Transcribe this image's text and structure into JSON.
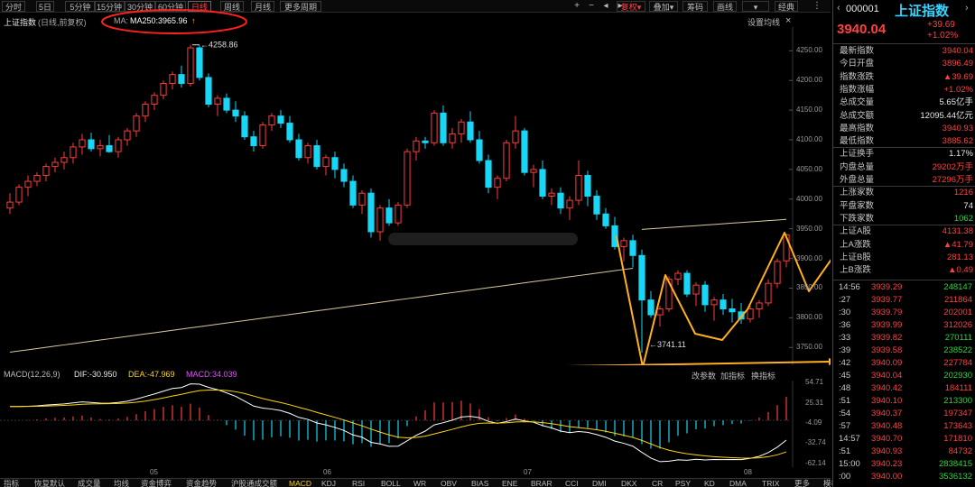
{
  "toolbar": {
    "periods": [
      "分时",
      "5日",
      "5分钟",
      "15分钟",
      "30分钟",
      "60分钟",
      "日线",
      "周线",
      "月线",
      "更多周期"
    ],
    "active_period": "日线",
    "icons": [
      "add-icon",
      "minus-icon",
      "left-icon",
      "right-icon"
    ],
    "buttons": [
      "复权",
      "叠加",
      "画线",
      "经典"
    ],
    "extra_buttons": [
      "筹码"
    ],
    "setting_label": "设置均线",
    "close_symbol": "×"
  },
  "chart": {
    "index_name": "上证指数",
    "mode": "(日线,前复权)",
    "ma_prefix": "MA:",
    "ma_label": "MA250:3965.96",
    "ma_arrow": "↑",
    "high_annotation": "4258.86",
    "low_annotation": "3741.11",
    "price_ticks": [
      "4250.00",
      "4200.00",
      "4150.00",
      "4100.00",
      "4050.00",
      "4000.00",
      "3950.00",
      "3900.00",
      "3850.00",
      "3800.00",
      "3750.00"
    ],
    "macd_label": "MACD(12,26,9)",
    "dif_label": "DIF:-30.950",
    "dea_label": "DEA:-47.969",
    "macd_value_label": "MACD:34.039",
    "macd_ticks": [
      "54.71",
      "25.31",
      "-4.09",
      "-32.74",
      "-62.14"
    ],
    "macd_buttons": [
      "改参数",
      "加指标",
      "换指标"
    ],
    "month_labels": [
      "05",
      "06",
      "07",
      "08"
    ],
    "colors": {
      "up": "#ff3b3b",
      "down": "#18d6f5",
      "ma": "#d7c9a0",
      "dif": "#ffffff",
      "dea": "#ffd400",
      "annotation": "#ffb020",
      "circle": "#ff2020"
    }
  },
  "right_panel": {
    "code": "000001",
    "name": "上证指数",
    "price": "3940.04",
    "change": "+39.69",
    "change_pct": "+1.02%",
    "stats": [
      {
        "label": "最新指数",
        "value": "3940.04",
        "color": "red"
      },
      {
        "label": "今日开盘",
        "value": "3896.49",
        "color": "red"
      },
      {
        "label": "指数涨跌",
        "value": "▲39.69",
        "color": "red"
      },
      {
        "label": "指数涨幅",
        "value": "+1.02%",
        "color": "red"
      },
      {
        "label": "总成交量",
        "value": "5.65亿手",
        "color": "white"
      },
      {
        "label": "总成交额",
        "value": "12095.44亿元",
        "color": "white"
      },
      {
        "label": "最高指数",
        "value": "3940.93",
        "color": "red"
      },
      {
        "label": "最低指数",
        "value": "3885.62",
        "color": "red"
      },
      {
        "label": "上证换手",
        "value": "1.17%",
        "color": "white"
      },
      {
        "label": "内盘总量",
        "value": "29202万手",
        "color": "red"
      },
      {
        "label": "外盘总量",
        "value": "27296万手",
        "color": "red"
      },
      {
        "label": "上涨家数",
        "value": "1216",
        "color": "red"
      },
      {
        "label": "平盘家数",
        "value": "74",
        "color": "white"
      },
      {
        "label": "下跌家数",
        "value": "1062",
        "color": "green"
      },
      {
        "label": "上证A股",
        "value": "4131.38",
        "color": "red"
      },
      {
        "label": "上A涨跌",
        "value": "▲41.79",
        "color": "red"
      },
      {
        "label": "上证B股",
        "value": "281.13",
        "color": "red"
      },
      {
        "label": "上B涨跌",
        "value": "▲0.49",
        "color": "red"
      }
    ],
    "ticks": [
      {
        "time": "14:56",
        "price": "3939.29",
        "vol": "248147",
        "pc": "red",
        "vc": "green"
      },
      {
        "time": ":27",
        "price": "3939.77",
        "vol": "211864",
        "pc": "red",
        "vc": "red"
      },
      {
        "time": ":30",
        "price": "3939.79",
        "vol": "202001",
        "pc": "red",
        "vc": "red"
      },
      {
        "time": ":36",
        "price": "3939.99",
        "vol": "312026",
        "pc": "red",
        "vc": "red"
      },
      {
        "time": ":33",
        "price": "3939.82",
        "vol": "270111",
        "pc": "red",
        "vc": "green"
      },
      {
        "time": ":39",
        "price": "3939.58",
        "vol": "238522",
        "pc": "red",
        "vc": "green"
      },
      {
        "time": ":42",
        "price": "3940.09",
        "vol": "227784",
        "pc": "red",
        "vc": "red"
      },
      {
        "time": ":45",
        "price": "3940.04",
        "vol": "202930",
        "pc": "red",
        "vc": "green"
      },
      {
        "time": ":48",
        "price": "3940.42",
        "vol": "184111",
        "pc": "red",
        "vc": "red"
      },
      {
        "time": ":51",
        "price": "3940.10",
        "vol": "213300",
        "pc": "red",
        "vc": "green"
      },
      {
        "time": ":54",
        "price": "3940.37",
        "vol": "197347",
        "pc": "red",
        "vc": "red"
      },
      {
        "time": ":57",
        "price": "3940.48",
        "vol": "173643",
        "pc": "red",
        "vc": "red"
      },
      {
        "time": "14:57",
        "price": "3940.70",
        "vol": "171810",
        "pc": "red",
        "vc": "red"
      },
      {
        "time": ":51",
        "price": "3940.93",
        "vol": "84732",
        "pc": "red",
        "vc": "red"
      },
      {
        "time": "15:00",
        "price": "3940.23",
        "vol": "2838415",
        "pc": "red",
        "vc": "green"
      },
      {
        "time": ":00",
        "price": "3940.00",
        "vol": "3536132",
        "pc": "red",
        "vc": "green"
      }
    ]
  },
  "bottom_tabs": [
    "指标",
    "恢复默认",
    "成交量",
    "均线",
    "资金博弈",
    "资金趋势",
    "沪股通成交额",
    "MACD",
    "KDJ",
    "RSI",
    "BOLL",
    "WR",
    "OBV",
    "BIAS",
    "ENE",
    "BRAR",
    "CCI",
    "DMI",
    "DKX",
    "CR",
    "PSY",
    "KD",
    "DMA",
    "TRIX",
    "更多",
    "模板"
  ],
  "selected_tab": "MACD",
  "chart_data": {
    "type": "candlestick",
    "title": "上证指数 (日线,前复权)",
    "ylim": [
      3720,
      4290
    ],
    "x_labels": [
      "05",
      "06",
      "07",
      "08"
    ],
    "price_annotations": {
      "high": 4258.86,
      "low": 3741.11
    },
    "ma250_last": 3965.96,
    "candles": [
      [
        3985,
        4010,
        3975,
        3995
      ],
      [
        3995,
        4025,
        3990,
        4020
      ],
      [
        4020,
        4040,
        4005,
        4030
      ],
      [
        4030,
        4045,
        4022,
        4040
      ],
      [
        4040,
        4060,
        4030,
        4055
      ],
      [
        4055,
        4070,
        4045,
        4062
      ],
      [
        4062,
        4080,
        4050,
        4070
      ],
      [
        4070,
        4095,
        4060,
        4088
      ],
      [
        4088,
        4110,
        4075,
        4100
      ],
      [
        4100,
        4112,
        4080,
        4085
      ],
      [
        4085,
        4100,
        4072,
        4090
      ],
      [
        4090,
        4108,
        4078,
        4080
      ],
      [
        4080,
        4105,
        4070,
        4100
      ],
      [
        4100,
        4120,
        4090,
        4115
      ],
      [
        4115,
        4145,
        4105,
        4140
      ],
      [
        4140,
        4165,
        4130,
        4160
      ],
      [
        4160,
        4180,
        4150,
        4175
      ],
      [
        4175,
        4200,
        4168,
        4195
      ],
      [
        4195,
        4215,
        4185,
        4210
      ],
      [
        4210,
        4225,
        4188,
        4195
      ],
      [
        4195,
        4260,
        4190,
        4255
      ],
      [
        4255,
        4259,
        4200,
        4205
      ],
      [
        4205,
        4212,
        4155,
        4160
      ],
      [
        4160,
        4175,
        4140,
        4170
      ],
      [
        4170,
        4178,
        4145,
        4150
      ],
      [
        4150,
        4165,
        4130,
        4140
      ],
      [
        4140,
        4148,
        4100,
        4105
      ],
      [
        4105,
        4115,
        4080,
        4090
      ],
      [
        4090,
        4130,
        4085,
        4125
      ],
      [
        4125,
        4145,
        4115,
        4140
      ],
      [
        4140,
        4150,
        4120,
        4128
      ],
      [
        4128,
        4140,
        4095,
        4100
      ],
      [
        4100,
        4110,
        4065,
        4070
      ],
      [
        4070,
        4095,
        4060,
        4090
      ],
      [
        4090,
        4100,
        4050,
        4055
      ],
      [
        4055,
        4075,
        4040,
        4070
      ],
      [
        4070,
        4080,
        4035,
        4050
      ],
      [
        4050,
        4060,
        4020,
        4030
      ],
      [
        4030,
        4040,
        3985,
        3990
      ],
      [
        3990,
        4015,
        3975,
        4010
      ],
      [
        4010,
        4018,
        3935,
        3945
      ],
      [
        3945,
        3990,
        3930,
        3985
      ],
      [
        3985,
        4000,
        3955,
        3960
      ],
      [
        3960,
        3995,
        3955,
        3990
      ],
      [
        3990,
        4085,
        3985,
        4080
      ],
      [
        4080,
        4105,
        4065,
        4098
      ],
      [
        4098,
        4105,
        4085,
        4095
      ],
      [
        4095,
        4150,
        4090,
        4145
      ],
      [
        4145,
        4158,
        4090,
        4095
      ],
      [
        4095,
        4120,
        4085,
        4110
      ],
      [
        4110,
        4135,
        4095,
        4130
      ],
      [
        4130,
        4148,
        4095,
        4100
      ],
      [
        4100,
        4115,
        4060,
        4065
      ],
      [
        4065,
        4075,
        4010,
        4020
      ],
      [
        4020,
        4040,
        4000,
        4035
      ],
      [
        4035,
        4100,
        4030,
        4095
      ],
      [
        4095,
        4140,
        4085,
        4115
      ],
      [
        4115,
        4120,
        4040,
        4045
      ],
      [
        4045,
        4058,
        4020,
        4050
      ],
      [
        4050,
        4065,
        4000,
        4005
      ],
      [
        4005,
        4018,
        3990,
        4010
      ],
      [
        4010,
        4020,
        3975,
        3985
      ],
      [
        3985,
        4005,
        3965,
        3998
      ],
      [
        3998,
        4065,
        3990,
        4040
      ],
      [
        4040,
        4048,
        3988,
        4005
      ],
      [
        4005,
        4015,
        3965,
        3975
      ],
      [
        3975,
        3985,
        3950,
        3955
      ],
      [
        3955,
        3970,
        3915,
        3920
      ],
      [
        3920,
        3935,
        3895,
        3930
      ],
      [
        3930,
        3940,
        3885,
        3905
      ],
      [
        3905,
        3915,
        3741,
        3830
      ],
      [
        3830,
        3845,
        3800,
        3805
      ],
      [
        3805,
        3820,
        3785,
        3815
      ],
      [
        3815,
        3870,
        3810,
        3865
      ],
      [
        3865,
        3880,
        3855,
        3875
      ],
      [
        3875,
        3880,
        3835,
        3840
      ],
      [
        3840,
        3860,
        3820,
        3855
      ],
      [
        3855,
        3862,
        3810,
        3822
      ],
      [
        3822,
        3835,
        3795,
        3830
      ],
      [
        3830,
        3840,
        3805,
        3815
      ],
      [
        3815,
        3832,
        3792,
        3810
      ],
      [
        3810,
        3825,
        3790,
        3798
      ],
      [
        3798,
        3820,
        3792,
        3815
      ],
      [
        3815,
        3830,
        3800,
        3825
      ],
      [
        3825,
        3865,
        3820,
        3858
      ],
      [
        3858,
        3900,
        3850,
        3895
      ],
      [
        3896,
        3941,
        3885,
        3940
      ]
    ],
    "macd": {
      "dif_last": -30.95,
      "dea_last": -47.969,
      "macd_last": 34.039,
      "ylim": [
        -62.14,
        54.71
      ]
    }
  }
}
